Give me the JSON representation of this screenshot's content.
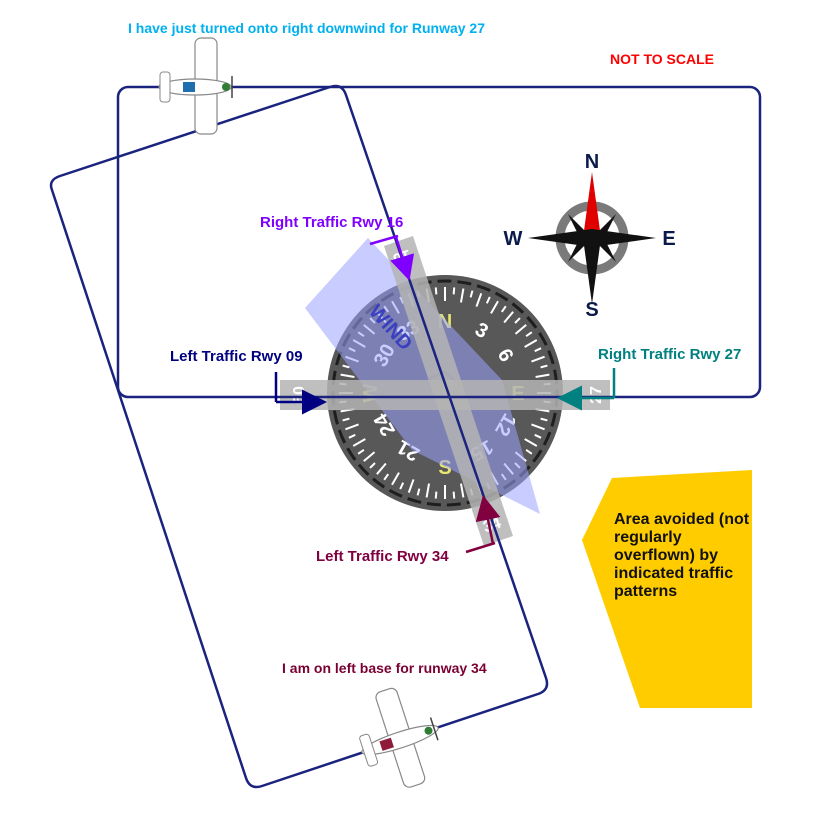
{
  "annotations": {
    "top_caption": "I have just turned onto right downwind for Runway 27",
    "bottom_caption": "I am on left base for runway 34",
    "not_to_scale": "NOT TO SCALE",
    "avoided_area": "Area avoided (not regularly overflown) by indicated traffic patterns"
  },
  "patterns": [
    {
      "label": "Right Traffic Rwy 16",
      "color": "#8000ff"
    },
    {
      "label": "Left Traffic Rwy 09",
      "color": "#000080"
    },
    {
      "label": "Right Traffic Rwy 27",
      "color": "#008080"
    },
    {
      "label": "Left Traffic Rwy 34",
      "color": "#800040"
    }
  ],
  "runways": {
    "09": "09",
    "27": "27",
    "16": "16",
    "34": "34"
  },
  "wind_label": "WIND",
  "compass_rose": {
    "north": "N",
    "east": "E",
    "south": "S",
    "west": "W"
  },
  "heading_indicator": {
    "cardinals": {
      "north": "N",
      "east": "E",
      "south": "S",
      "west": "W"
    },
    "numbers": [
      "3",
      "6",
      "12",
      "15",
      "21",
      "24",
      "30",
      "33"
    ]
  },
  "colors": {
    "pattern_line": "#1a237e",
    "caption_top": "#00b0f0",
    "caption_bottom": "#7b0032",
    "warning": "#ff0000",
    "avoid_fill": "#ffcc00",
    "indicator_face": "#5a5a5a",
    "indicator_text": "#e8e870",
    "wind_fill": "#9aa2ff"
  }
}
